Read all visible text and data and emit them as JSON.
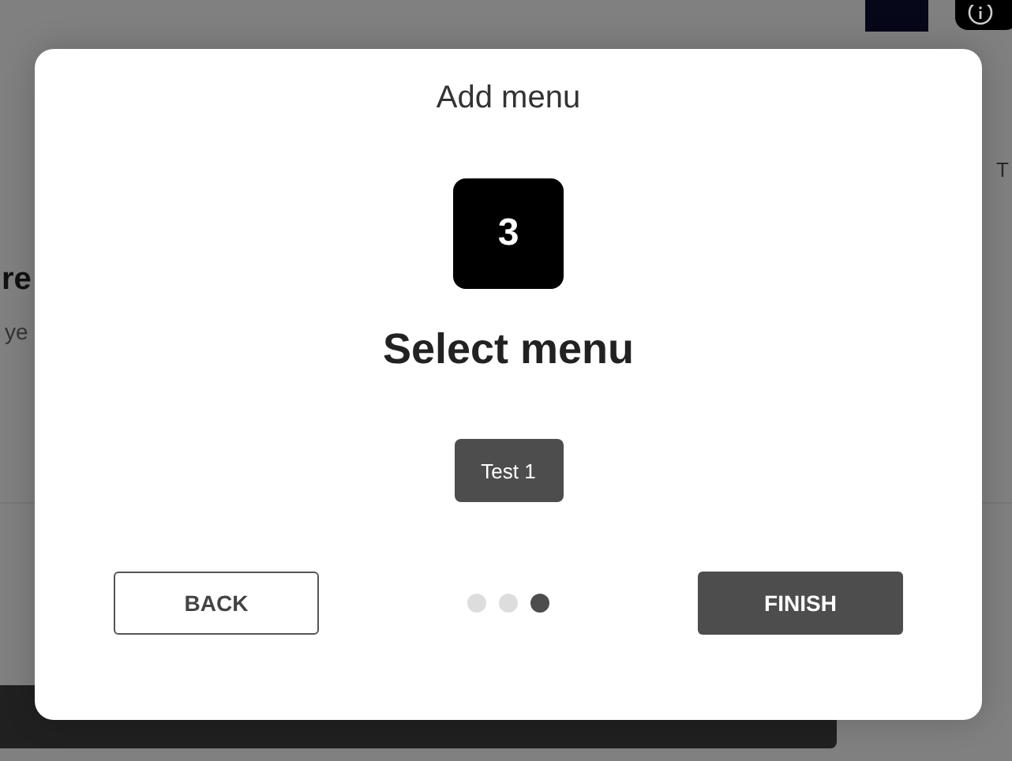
{
  "background": {
    "heading_fragment": "re",
    "text_fragment": "ye",
    "side_fragment": "T"
  },
  "dialog": {
    "title": "Add menu",
    "step": "3",
    "heading": "Select menu",
    "menus": [
      {
        "label": "Test 1"
      }
    ],
    "back": "BACK",
    "finish": "FINISH",
    "steps": [
      {
        "selected": false
      },
      {
        "selected": false
      },
      {
        "selected": true
      }
    ]
  }
}
